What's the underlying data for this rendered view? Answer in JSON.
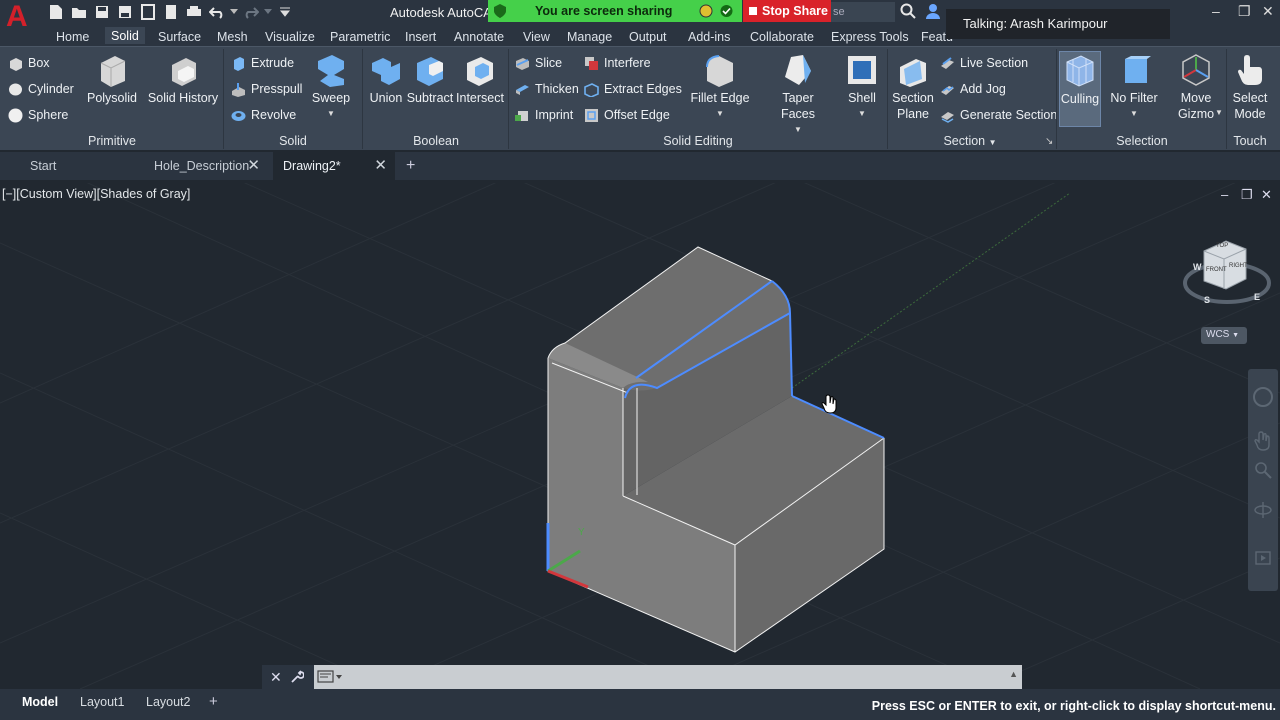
{
  "app": {
    "title": "Autodesk AutoCA",
    "talking": "Talking: Arash Karimpour",
    "search_placeholder": "se"
  },
  "screen_share": {
    "status": "You are screen sharing",
    "stop_label": "Stop Share"
  },
  "ribbon_tabs": [
    "Home",
    "Solid",
    "Surface",
    "Mesh",
    "Visualize",
    "Parametric",
    "Insert",
    "Annotate",
    "View",
    "Manage",
    "Output",
    "Add-ins",
    "Collaborate",
    "Express Tools",
    "Featu"
  ],
  "active_ribbon_tab": "Solid",
  "panels": {
    "primitive": {
      "title": "Primitive",
      "box": "Box",
      "cylinder": "Cylinder",
      "sphere": "Sphere",
      "polysolid": "Polysolid",
      "solid_history": "Solid History"
    },
    "solid": {
      "title": "Solid",
      "extrude": "Extrude",
      "presspull": "Presspull",
      "revolve": "Revolve",
      "sweep": "Sweep"
    },
    "boolean": {
      "title": "Boolean",
      "union": "Union",
      "subtract": "Subtract",
      "intersect": "Intersect"
    },
    "solid_editing": {
      "title": "Solid Editing",
      "slice": "Slice",
      "thicken": "Thicken",
      "imprint": "Imprint",
      "interfere": "Interfere",
      "extract_edges": "Extract Edges",
      "offset_edge": "Offset Edge",
      "fillet_edge": "Fillet Edge",
      "taper_faces": "Taper Faces",
      "shell": "Shell"
    },
    "section": {
      "title": "Section",
      "section_plane_1": "Section",
      "section_plane_2": "Plane",
      "live_section": "Live Section",
      "add_jog": "Add Jog",
      "generate_section": "Generate Section"
    },
    "selection": {
      "title": "Selection",
      "culling": "Culling",
      "no_filter": "No Filter",
      "move_gizmo_1": "Move",
      "move_gizmo_2": "Gizmo"
    },
    "touch": {
      "title": "Touch",
      "select_mode_1": "Select",
      "select_mode_2": "Mode"
    }
  },
  "file_tabs": [
    {
      "label": "Start"
    },
    {
      "label": "Hole_Description"
    },
    {
      "label": "Drawing2*"
    }
  ],
  "viewport": {
    "label": "[−][Custom View][Shades of Gray]",
    "wcs": "WCS",
    "viewcube": {
      "top": "TOP",
      "front": "FRONT",
      "right": "RIGHT",
      "w": "W",
      "s": "S",
      "e": "E"
    },
    "ucs_y": "Y"
  },
  "layout_tabs": [
    "Model",
    "Layout1",
    "Layout2"
  ],
  "status_message": "Press ESC or ENTER to exit, or right-click to display shortcut-menu.",
  "colors": {
    "accent_blue": "#4d8cff",
    "background": "#212830",
    "share_green": "#45d04a",
    "stop_red": "#d9222a"
  }
}
